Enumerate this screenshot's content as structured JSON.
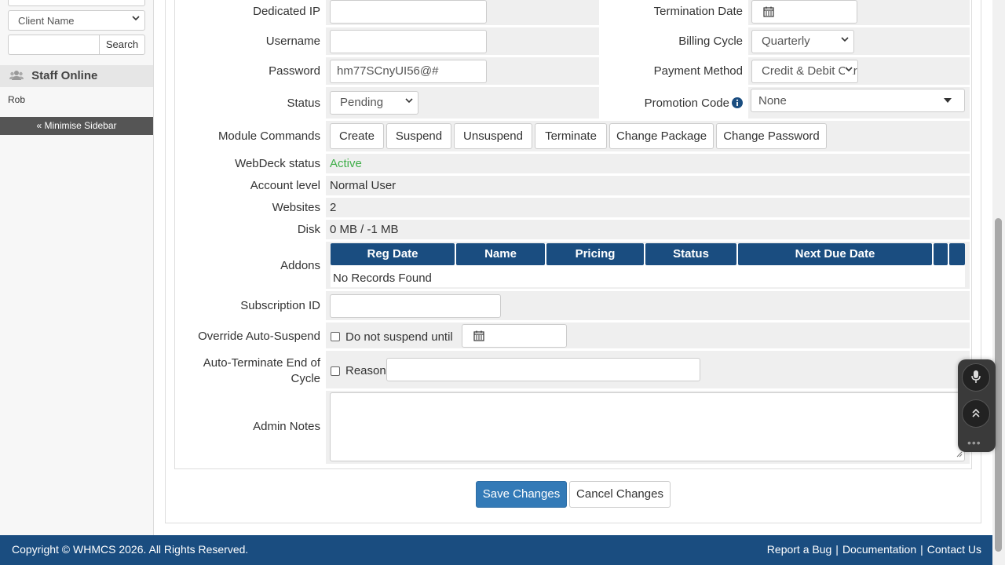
{
  "sidebar": {
    "client_select": "Client Name",
    "search_button": "Search",
    "staff_heading": "Staff Online",
    "staff_members": [
      "Rob"
    ],
    "minimise_label": "« Minimise Sidebar"
  },
  "form": {
    "dedicated_ip": {
      "label": "Dedicated IP",
      "value": ""
    },
    "termination_date": {
      "label": "Termination Date",
      "value": ""
    },
    "username": {
      "label": "Username",
      "value": ""
    },
    "billing_cycle": {
      "label": "Billing Cycle",
      "value": "Quarterly"
    },
    "password": {
      "label": "Password",
      "value": "hm77SCnyUI56@#"
    },
    "payment_method": {
      "label": "Payment Method",
      "value": "Credit & Debit Card"
    },
    "status": {
      "label": "Status",
      "value": "Pending"
    },
    "promotion_code": {
      "label": "Promotion Code",
      "value": "None"
    },
    "module_commands": {
      "label": "Module Commands",
      "buttons": [
        "Create",
        "Suspend",
        "Unsuspend",
        "Terminate",
        "Change Package",
        "Change Password"
      ]
    },
    "webdeck_status": {
      "label": "WebDeck status",
      "value": "Active"
    },
    "account_level": {
      "label": "Account level",
      "value": "Normal User"
    },
    "websites": {
      "label": "Websites",
      "value": "2"
    },
    "disk": {
      "label": "Disk",
      "value": "0 MB / -1 MB"
    },
    "addons": {
      "label": "Addons",
      "columns": [
        "Reg Date",
        "Name",
        "Pricing",
        "Status",
        "Next Due Date",
        "",
        ""
      ],
      "empty_text": "No Records Found"
    },
    "subscription_id": {
      "label": "Subscription ID",
      "value": ""
    },
    "override_auto_suspend": {
      "label": "Override Auto-Suspend",
      "checkbox_label": "Do not suspend until",
      "value": ""
    },
    "auto_terminate": {
      "label_line1": "Auto-Terminate End of",
      "label_line2": "Cycle",
      "checkbox_label": "Reason",
      "value": ""
    },
    "admin_notes": {
      "label": "Admin Notes",
      "value": ""
    }
  },
  "actions": {
    "save": "Save Changes",
    "cancel": "Cancel Changes"
  },
  "footer": {
    "copyright": "Copyright © WHMCS 2026. All Rights Reserved.",
    "links": [
      "Report a Bug",
      "Documentation",
      "Contact Us"
    ],
    "separator": "|"
  },
  "colors": {
    "brand_blue": "#1a4d80",
    "primary_button": "#337ab7",
    "active_green": "#3fae49"
  }
}
